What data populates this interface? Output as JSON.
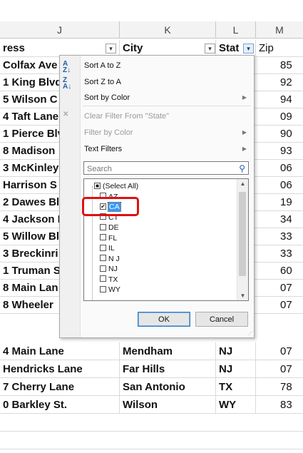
{
  "columns": [
    "J",
    "K",
    "L",
    "M"
  ],
  "header": {
    "address": "ress",
    "city": "City",
    "state": "Stat",
    "zip": "Zip"
  },
  "rows_partial": [
    {
      "address": "Colfax Ave",
      "zip": "85"
    },
    {
      "address": "1 King Blvd",
      "zip": "92"
    },
    {
      "address": "5 Wilson C",
      "zip": "94"
    },
    {
      "address": "4 Taft Lane",
      "zip": "09"
    },
    {
      "address": "1 Pierce Blv",
      "zip": "90"
    },
    {
      "address": "8 Madison",
      "zip": "93"
    },
    {
      "address": "3 McKinley",
      "zip": "06"
    },
    {
      "address": "Harrison S",
      "zip": "06"
    },
    {
      "address": "2 Dawes Bl",
      "zip": "19"
    },
    {
      "address": "4 Jackson E",
      "zip": "34"
    },
    {
      "address": "5 Willow Bl",
      "zip": "33"
    },
    {
      "address": "3 Breckinri",
      "zip": "33"
    },
    {
      "address": "1 Truman S",
      "zip": "60"
    },
    {
      "address": "8 Main Lan",
      "zip": "07"
    },
    {
      "address": "8 Wheeler",
      "zip": "07"
    }
  ],
  "rows_full": [
    {
      "address": "4 Main Lane",
      "city": "Mendham",
      "state": "NJ",
      "zip": "07"
    },
    {
      "address": "Hendricks Lane",
      "city": "Far Hills",
      "state": "NJ",
      "zip": "07"
    },
    {
      "address": "7 Cherry Lane",
      "city": "San Antonio",
      "state": "TX",
      "zip": "78"
    },
    {
      "address": "0 Barkley St.",
      "city": "Wilson",
      "state": "WY",
      "zip": "83"
    }
  ],
  "filter_menu": {
    "sort_az": "Sort A to Z",
    "sort_za": "Sort Z to A",
    "sort_color": "Sort by Color",
    "clear_filter": "Clear Filter From \"State\"",
    "filter_color": "Filter by Color",
    "text_filters": "Text Filters",
    "search_placeholder": "Search",
    "items": [
      {
        "label": "(Select All)",
        "state": "partial"
      },
      {
        "label": "AZ",
        "state": "unchecked"
      },
      {
        "label": "CA",
        "state": "checked"
      },
      {
        "label": "CT",
        "state": "unchecked"
      },
      {
        "label": "DE",
        "state": "unchecked"
      },
      {
        "label": "FL",
        "state": "unchecked"
      },
      {
        "label": "IL",
        "state": "unchecked"
      },
      {
        "label": "N J",
        "state": "unchecked"
      },
      {
        "label": "NJ",
        "state": "unchecked"
      },
      {
        "label": "TX",
        "state": "unchecked"
      },
      {
        "label": "WY",
        "state": "unchecked"
      }
    ],
    "ok": "OK",
    "cancel": "Cancel"
  },
  "colors": {
    "highlight": "#3399ff",
    "annotation": "#e01010"
  }
}
